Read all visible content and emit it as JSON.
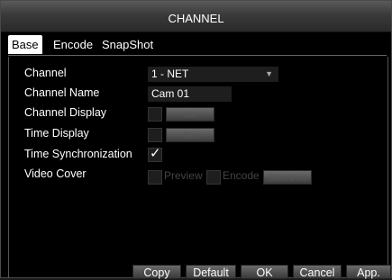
{
  "window": {
    "title": "CHANNEL"
  },
  "tabs": [
    {
      "label": "Base",
      "active": true
    },
    {
      "label": "Encode",
      "active": false
    },
    {
      "label": "SnapShot",
      "active": false
    }
  ],
  "form": {
    "channel": {
      "label": "Channel",
      "value": "1 - NET",
      "icon": "dropdown-arrow-icon"
    },
    "channel_name": {
      "label": "Channel Name",
      "value": "Cam 01"
    },
    "channel_display": {
      "label": "Channel Display",
      "checked": false,
      "button": "Set"
    },
    "time_display": {
      "label": "Time Display",
      "checked": false,
      "button": "Set"
    },
    "time_sync": {
      "label": "Time Synchronization",
      "checked": true
    },
    "video_cover": {
      "label": "Video Cover",
      "preview": "Preview",
      "encode": "Encode",
      "button": "Set Area"
    }
  },
  "footer": {
    "copy": "Copy",
    "default": "Default",
    "ok": "OK",
    "cancel": "Cancel",
    "apply": "App."
  }
}
